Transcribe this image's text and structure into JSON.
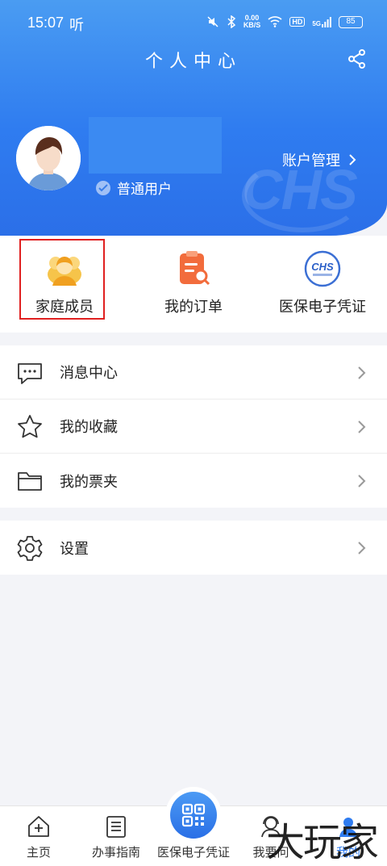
{
  "status_bar": {
    "time": "15:07",
    "audio_glyph": "听",
    "net_speed_value": "0.00",
    "net_speed_unit": "KB/S",
    "hd": "HD",
    "signal": "5G",
    "battery": "85"
  },
  "header": {
    "title": "个人中心",
    "role": "普通用户",
    "account_mgmt": "账户管理",
    "watermark_text": "CHS"
  },
  "quick_actions": [
    {
      "label": "家庭成员",
      "icon": "family-member-icon"
    },
    {
      "label": "我的订单",
      "icon": "order-icon"
    },
    {
      "label": "医保电子凭证",
      "icon": "chs-logo-icon"
    }
  ],
  "menu_group_1": [
    {
      "label": "消息中心",
      "icon": "message-icon"
    },
    {
      "label": "我的收藏",
      "icon": "star-icon"
    },
    {
      "label": "我的票夹",
      "icon": "folder-icon"
    }
  ],
  "menu_group_2": [
    {
      "label": "设置",
      "icon": "gear-icon"
    }
  ],
  "tabbar": [
    {
      "label": "主页",
      "icon": "home-icon"
    },
    {
      "label": "办事指南",
      "icon": "guide-icon"
    },
    {
      "label": "医保电子凭证",
      "icon": "qr-code-icon"
    },
    {
      "label": "我要问",
      "icon": "service-icon"
    },
    {
      "label": "我的",
      "icon": "profile-icon"
    }
  ],
  "watermark": "大玩家",
  "colors": {
    "primary": "#2f7cf0",
    "highlight": "#e02020",
    "background": "#f3f4f8"
  }
}
